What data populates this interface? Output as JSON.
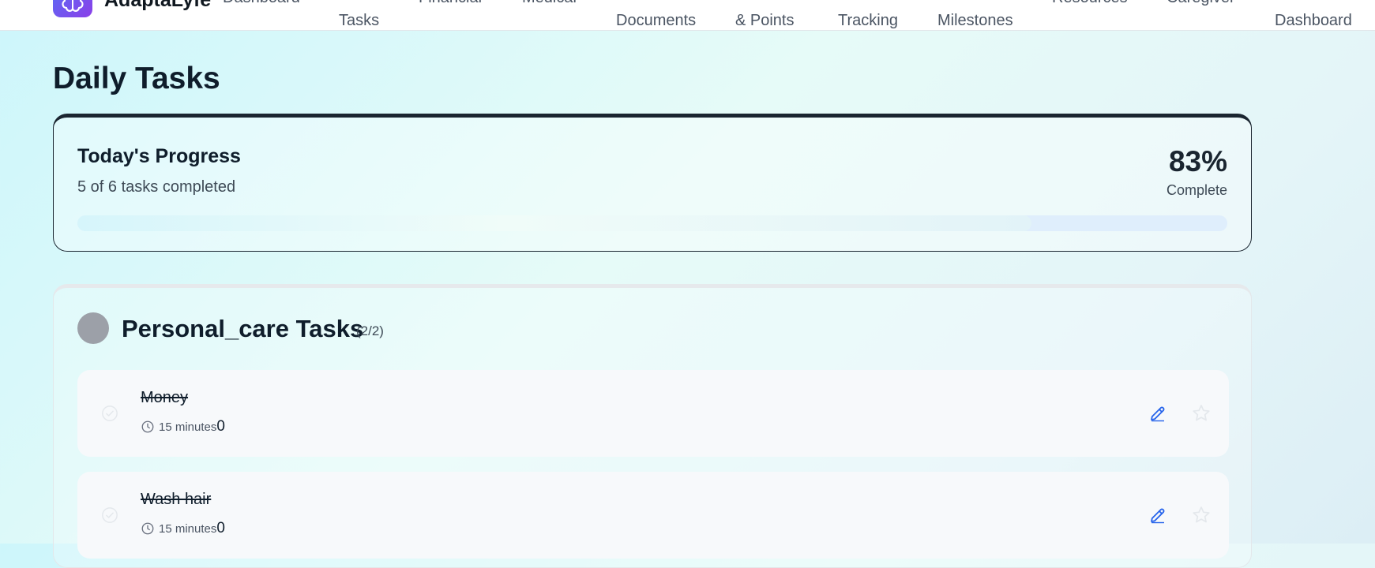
{
  "app": {
    "name": "AdaptaLyfe"
  },
  "nav": {
    "items": [
      {
        "l1": "Dashboard",
        "l2": ""
      },
      {
        "l1": "",
        "l2": "Tasks"
      },
      {
        "l1": "Financial",
        "l2": ""
      },
      {
        "l1": "Medical",
        "l2": ""
      },
      {
        "l1": "",
        "l2": "Documents"
      },
      {
        "l1": "",
        "l2": "& Points"
      },
      {
        "l1": "",
        "l2": "Tracking"
      },
      {
        "l1": "",
        "l2": "Milestones"
      },
      {
        "l1": "Resources",
        "l2": ""
      },
      {
        "l1": "Caregiver",
        "l2": ""
      },
      {
        "l1": "",
        "l2": "Dashboard"
      }
    ]
  },
  "page": {
    "title": "Daily Tasks"
  },
  "progress": {
    "title": "Today's Progress",
    "subtitle": "5 of 6 tasks completed",
    "percent_label": "83%",
    "complete_label": "Complete",
    "fraction": 0.83
  },
  "category": {
    "title": "Personal_care Tasks",
    "count": "(2/2)",
    "dot_color": "#9ca0a8",
    "tasks": [
      {
        "name": "Money",
        "duration": "15 minutes",
        "points": "0"
      },
      {
        "name": "Wash hair",
        "duration": "15 minutes",
        "points": "0"
      }
    ]
  },
  "colors": {
    "accent_edit": "#2563eb",
    "logo_gradient_start": "#5b6cf5",
    "logo_gradient_end": "#8a3fe8"
  },
  "icons": {
    "logo": "brain-icon",
    "task_check": "check-circle-icon",
    "duration": "clock-icon",
    "edit": "pencil-icon",
    "favorite": "star-icon"
  }
}
